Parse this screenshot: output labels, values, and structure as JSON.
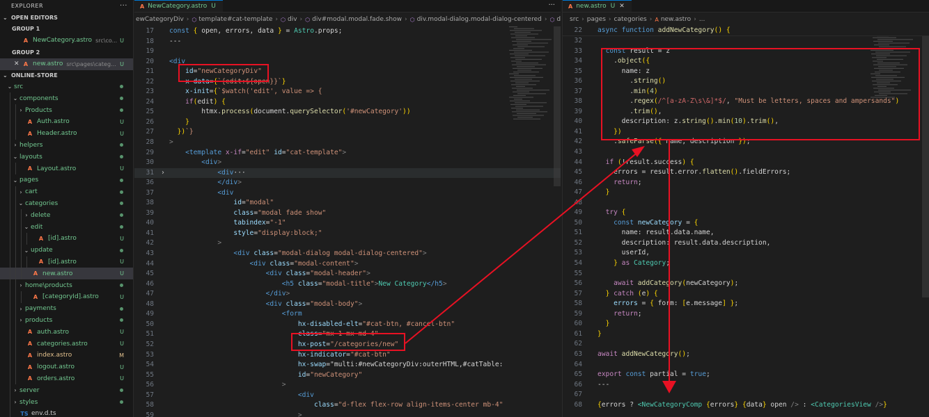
{
  "explorer": {
    "title": "EXPLORER",
    "open_editors": "OPEN EDITORS",
    "group1": "GROUP 1",
    "group1_file": {
      "name": "NewCategory.astro",
      "desc": "src\\co...",
      "status": "U"
    },
    "group2": "GROUP 2",
    "group2_file": {
      "name": "new.astro",
      "desc": "src\\pages\\categ...",
      "status": "U"
    },
    "project": "ONLINE-STORE",
    "tree": [
      {
        "name": "src",
        "status": "dot"
      },
      {
        "name": "components",
        "status": "dot"
      },
      {
        "name": "Products",
        "status": "dot"
      },
      {
        "name": "Auth.astro",
        "status": "U"
      },
      {
        "name": "Header.astro",
        "status": "U"
      },
      {
        "name": "helpers",
        "status": "dot"
      },
      {
        "name": "layouts",
        "status": "dot"
      },
      {
        "name": "Layout.astro",
        "status": "U"
      },
      {
        "name": "pages",
        "status": "dot"
      },
      {
        "name": "cart",
        "status": "dot"
      },
      {
        "name": "categories",
        "status": "dot"
      },
      {
        "name": "delete",
        "status": "dot"
      },
      {
        "name": "edit",
        "status": "dot"
      },
      {
        "name": "[id].astro",
        "status": "U"
      },
      {
        "name": "update",
        "status": "dot"
      },
      {
        "name": "[id].astro",
        "status": "U"
      },
      {
        "name": "new.astro",
        "status": "U"
      },
      {
        "name": "home\\products",
        "status": "dot"
      },
      {
        "name": "[categoryId].astro",
        "status": "U"
      },
      {
        "name": "payments",
        "status": "dot"
      },
      {
        "name": "products",
        "status": "dot"
      },
      {
        "name": "auth.astro",
        "status": "U"
      },
      {
        "name": "categories.astro",
        "status": "U"
      },
      {
        "name": "index.astro",
        "status": "M"
      },
      {
        "name": "logout.astro",
        "status": "U"
      },
      {
        "name": "orders.astro",
        "status": "U"
      },
      {
        "name": "server",
        "status": "dot"
      },
      {
        "name": "styles",
        "status": "dot"
      },
      {
        "name": "env.d.ts",
        "status": ""
      }
    ]
  },
  "left_editor": {
    "tab": {
      "label": "NewCategory.astro",
      "status": "U"
    },
    "breadcrumb": [
      "ewCategoryDiv",
      "template#cat-template",
      "div",
      "div#modal.modal.fade.show",
      "div.modal-dialog.modal-dialog-centered",
      "di"
    ],
    "lines": [
      {
        "n": "17",
        "text": "const { open, errors, data } = Astro.props;"
      },
      {
        "n": "18",
        "text": "---"
      },
      {
        "n": "19",
        "text": ""
      },
      {
        "n": "20",
        "text": "<div"
      },
      {
        "n": "21",
        "text": "    id=\"newCategoryDiv\""
      },
      {
        "n": "22",
        "text": "    x-data={`{edit:${open}}`}"
      },
      {
        "n": "23",
        "text": "    x-init={`$watch('edit', value => {"
      },
      {
        "n": "24",
        "text": "    if(edit) {"
      },
      {
        "n": "25",
        "text": "        htmx.process(document.querySelector('#newCategory'))"
      },
      {
        "n": "26",
        "text": "    }"
      },
      {
        "n": "27",
        "text": "  })`}"
      },
      {
        "n": "28",
        "text": ">"
      },
      {
        "n": "29",
        "text": "    <template x-if=\"edit\" id=\"cat-template\">"
      },
      {
        "n": "30",
        "text": "        <div>"
      },
      {
        "n": "31",
        "text": "            <div···"
      },
      {
        "n": "36",
        "text": "            </div>"
      },
      {
        "n": "37",
        "text": "            <div"
      },
      {
        "n": "38",
        "text": "                id=\"modal\""
      },
      {
        "n": "39",
        "text": "                class=\"modal fade show\""
      },
      {
        "n": "40",
        "text": "                tabindex=\"-1\""
      },
      {
        "n": "41",
        "text": "                style=\"display:block;\""
      },
      {
        "n": "42",
        "text": "            >"
      },
      {
        "n": "43",
        "text": "                <div class=\"modal-dialog modal-dialog-centered\">"
      },
      {
        "n": "44",
        "text": "                    <div class=\"modal-content\">"
      },
      {
        "n": "45",
        "text": "                        <div class=\"modal-header\">"
      },
      {
        "n": "46",
        "text": "                            <h5 class=\"modal-title\">New Category</h5>"
      },
      {
        "n": "47",
        "text": "                        </div>"
      },
      {
        "n": "48",
        "text": "                        <div class=\"modal-body\">"
      },
      {
        "n": "49",
        "text": "                            <form"
      },
      {
        "n": "50",
        "text": "                                hx-disabled-elt=\"#cat-btn, #cancel-btn\""
      },
      {
        "n": "51",
        "text": "                                class=\"mx-1 mx-md-4\""
      },
      {
        "n": "52",
        "text": "                                hx-post=\"/categories/new\""
      },
      {
        "n": "53",
        "text": "                                hx-indicator=\"#cat-btn\""
      },
      {
        "n": "54",
        "text": "                                hx-swap=\"multi:#newCategoryDiv:outerHTML,#catTable:"
      },
      {
        "n": "55",
        "text": "                                id=\"newCategory\""
      },
      {
        "n": "56",
        "text": "                            >"
      },
      {
        "n": "57",
        "text": "                                <div"
      },
      {
        "n": "58",
        "text": "                                    class=\"d-flex flex-row align-items-center mb-4\""
      },
      {
        "n": "59",
        "text": "                                >"
      }
    ]
  },
  "right_editor": {
    "tab": {
      "label": "new.astro",
      "status": "U"
    },
    "breadcrumb": [
      "src",
      "pages",
      "categories",
      "new.astro",
      "..."
    ],
    "sticky": {
      "n": "22",
      "text": "async function addNewCategory() {"
    },
    "lines": [
      {
        "n": "32",
        "text": ""
      },
      {
        "n": "33",
        "text": "  const result = z"
      },
      {
        "n": "34",
        "text": "    .object({"
      },
      {
        "n": "35",
        "text": "      name: z"
      },
      {
        "n": "36",
        "text": "        .string()"
      },
      {
        "n": "37",
        "text": "        .min(4)"
      },
      {
        "n": "38",
        "text": "        .regex(/^[a-zA-Z\\s\\&]*$/, \"Must be letters, spaces and ampersands\")"
      },
      {
        "n": "39",
        "text": "        .trim(),"
      },
      {
        "n": "40",
        "text": "      description: z.string().min(10).trim(),"
      },
      {
        "n": "41",
        "text": "    })"
      },
      {
        "n": "42",
        "text": "    .safeParse({ name, description });"
      },
      {
        "n": "43",
        "text": ""
      },
      {
        "n": "44",
        "text": "  if (!result.success) {"
      },
      {
        "n": "45",
        "text": "    errors = result.error.flatten().fieldErrors;"
      },
      {
        "n": "46",
        "text": "    return;"
      },
      {
        "n": "47",
        "text": "  }"
      },
      {
        "n": "48",
        "text": ""
      },
      {
        "n": "49",
        "text": "  try {"
      },
      {
        "n": "50",
        "text": "    const newCategory = {"
      },
      {
        "n": "51",
        "text": "      name: result.data.name,"
      },
      {
        "n": "52",
        "text": "      description: result.data.description,"
      },
      {
        "n": "53",
        "text": "      userId,"
      },
      {
        "n": "54",
        "text": "    } as Category;"
      },
      {
        "n": "55",
        "text": ""
      },
      {
        "n": "56",
        "text": "    await addCategory(newCategory);"
      },
      {
        "n": "57",
        "text": "  } catch (e) {"
      },
      {
        "n": "58",
        "text": "    errors = { form: [e.message] };"
      },
      {
        "n": "59",
        "text": "    return;"
      },
      {
        "n": "60",
        "text": "  }"
      },
      {
        "n": "61",
        "text": "}"
      },
      {
        "n": "62",
        "text": ""
      },
      {
        "n": "63",
        "text": "await addNewCategory();"
      },
      {
        "n": "64",
        "text": ""
      },
      {
        "n": "65",
        "text": "export const partial = true;"
      },
      {
        "n": "66",
        "text": "---"
      },
      {
        "n": "67",
        "text": ""
      },
      {
        "n": "68",
        "text": "{errors ? <NewCategoryComp {errors} {data} open /> : <CategoriesView />}"
      }
    ]
  },
  "colors": {
    "annotation": "#e81123",
    "modified": "#e2c08d",
    "untracked": "#73c991"
  }
}
